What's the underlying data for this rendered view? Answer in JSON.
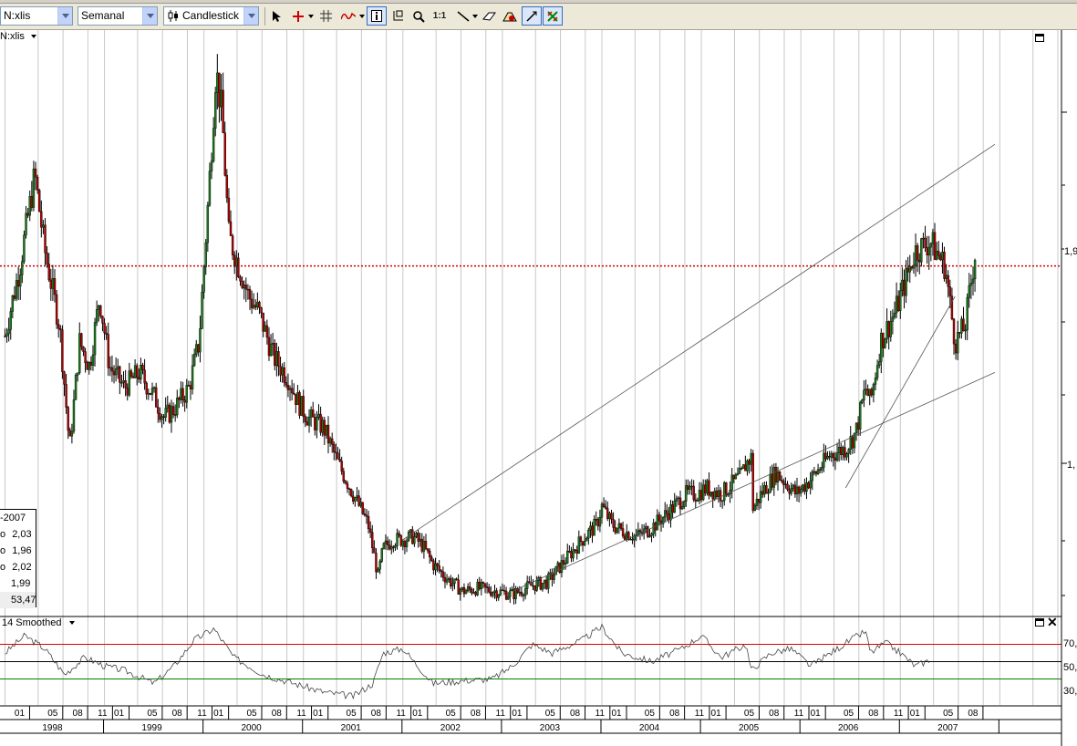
{
  "toolbar": {
    "symbol": "N:xlis",
    "period": "Semanal",
    "chart_style": "Candlestick",
    "icons": [
      "pointer-icon",
      "crosshair-icon",
      "grid-icon",
      "indicator-icon",
      "info-icon",
      "zoom-area-icon",
      "zoom-icon",
      "zoom-reset-icon",
      "line-tool-icon",
      "eraser-icon",
      "properties-icon",
      "autoscale-icon",
      "grid-toggle-icon"
    ],
    "zoom_reset_label": "1:1"
  },
  "price_panel": {
    "title": "N:xlis",
    "price_tags": {
      "current": "1,9",
      "lower": "1,"
    },
    "reference_line_color": "#cc0000"
  },
  "data_window": {
    "date": "-2007",
    "rows": [
      {
        "label": "o",
        "value": "2,03"
      },
      {
        "label": "o",
        "value": "1,96"
      },
      {
        "label": "o",
        "value": "2,02"
      },
      {
        "label": "",
        "value": "1,99"
      },
      {
        "label": "",
        "value": "53,47"
      }
    ]
  },
  "indicator_panel": {
    "title": "14 Smoothed",
    "levels": [
      "70,",
      "50,",
      "30,"
    ],
    "level_colors": {
      "upper": "#e00000",
      "middle": "#000000",
      "lower": "#008000"
    }
  },
  "time_axis": {
    "months": [
      "01",
      "05",
      "08",
      "11",
      "01",
      "05",
      "08",
      "11",
      "01",
      "05",
      "08",
      "11",
      "01",
      "05",
      "08",
      "11",
      "01",
      "05",
      "08",
      "11",
      "01",
      "05",
      "08",
      "11",
      "01",
      "05",
      "08",
      "11",
      "01",
      "05",
      "08",
      "11",
      "01",
      "05",
      "08",
      "11",
      "01",
      "05",
      "08"
    ],
    "years": [
      "1998",
      "1999",
      "2000",
      "2001",
      "2002",
      "2003",
      "2004",
      "2005",
      "2006",
      "2007"
    ]
  },
  "chart_data": {
    "type": "candlestick",
    "period": "weekly",
    "x_range": [
      "1998-01",
      "2007-10"
    ],
    "price_path": [
      [
        1998.0,
        1.72
      ],
      [
        1998.15,
        1.95
      ],
      [
        1998.3,
        2.25
      ],
      [
        1998.4,
        2.0
      ],
      [
        1998.55,
        1.75
      ],
      [
        1998.65,
        1.35
      ],
      [
        1998.75,
        1.7
      ],
      [
        1998.85,
        1.62
      ],
      [
        1998.95,
        1.85
      ],
      [
        1999.05,
        1.62
      ],
      [
        1999.2,
        1.55
      ],
      [
        1999.35,
        1.6
      ],
      [
        1999.5,
        1.52
      ],
      [
        1999.6,
        1.45
      ],
      [
        1999.7,
        1.48
      ],
      [
        1999.85,
        1.55
      ],
      [
        1999.95,
        1.7
      ],
      [
        2000.05,
        2.2
      ],
      [
        2000.12,
        2.6
      ],
      [
        2000.18,
        2.45
      ],
      [
        2000.25,
        2.05
      ],
      [
        2000.35,
        1.95
      ],
      [
        2000.45,
        1.85
      ],
      [
        2000.55,
        1.8
      ],
      [
        2000.7,
        1.65
      ],
      [
        2000.85,
        1.58
      ],
      [
        2000.95,
        1.5
      ],
      [
        2001.05,
        1.45
      ],
      [
        2001.2,
        1.42
      ],
      [
        2001.35,
        1.3
      ],
      [
        2001.5,
        1.2
      ],
      [
        2001.65,
        1.1
      ],
      [
        2001.75,
        0.93
      ],
      [
        2001.8,
        1.02
      ],
      [
        2001.9,
        1.05
      ],
      [
        2002.0,
        1.05
      ],
      [
        2002.1,
        1.06
      ],
      [
        2002.2,
        1.03
      ],
      [
        2002.3,
        0.97
      ],
      [
        2002.45,
        0.92
      ],
      [
        2002.6,
        0.88
      ],
      [
        2002.75,
        0.89
      ],
      [
        2002.95,
        0.88
      ],
      [
        2003.1,
        0.87
      ],
      [
        2003.3,
        0.9
      ],
      [
        2003.45,
        0.91
      ],
      [
        2003.6,
        0.97
      ],
      [
        2003.8,
        1.05
      ],
      [
        2003.95,
        1.1
      ],
      [
        2004.0,
        1.16
      ],
      [
        2004.1,
        1.1
      ],
      [
        2004.2,
        1.08
      ],
      [
        2004.35,
        1.06
      ],
      [
        2004.5,
        1.09
      ],
      [
        2004.7,
        1.15
      ],
      [
        2004.85,
        1.2
      ],
      [
        2004.95,
        1.2
      ],
      [
        2005.05,
        1.22
      ],
      [
        2005.2,
        1.2
      ],
      [
        2005.4,
        1.26
      ],
      [
        2005.45,
        1.3
      ],
      [
        2005.5,
        1.32
      ],
      [
        2005.52,
        1.15
      ],
      [
        2005.6,
        1.2
      ],
      [
        2005.75,
        1.27
      ],
      [
        2005.9,
        1.22
      ],
      [
        2005.95,
        1.2
      ],
      [
        2006.1,
        1.25
      ],
      [
        2006.3,
        1.33
      ],
      [
        2006.45,
        1.35
      ],
      [
        2006.55,
        1.4
      ],
      [
        2006.65,
        1.55
      ],
      [
        2006.7,
        1.5
      ],
      [
        2006.8,
        1.7
      ],
      [
        2006.95,
        1.8
      ],
      [
        2007.05,
        1.9
      ],
      [
        2007.15,
        2.0
      ],
      [
        2007.3,
        2.03
      ],
      [
        2007.45,
        1.95
      ],
      [
        2007.55,
        1.7
      ],
      [
        2007.65,
        1.75
      ],
      [
        2007.75,
        1.99
      ]
    ],
    "reference_price": 1.95,
    "channel_lines": [
      {
        "from": [
          2002.0,
          1.05
        ],
        "to": [
          2007.95,
          2.35
        ]
      },
      {
        "from": [
          2003.1,
          0.88
        ],
        "to": [
          2007.95,
          1.6
        ]
      },
      {
        "from": [
          2006.45,
          1.22
        ],
        "to": [
          2007.55,
          1.85
        ]
      }
    ],
    "indicator": {
      "name": "14 Smoothed",
      "levels": [
        70,
        50,
        30
      ],
      "values_at": [
        [
          1998.0,
          60
        ],
        [
          1998.2,
          80
        ],
        [
          1998.4,
          65
        ],
        [
          1998.6,
          35
        ],
        [
          1998.8,
          55
        ],
        [
          1999.0,
          45
        ],
        [
          1999.2,
          40
        ],
        [
          1999.5,
          25
        ],
        [
          1999.7,
          45
        ],
        [
          1999.9,
          75
        ],
        [
          2000.1,
          88
        ],
        [
          2000.3,
          55
        ],
        [
          2000.6,
          35
        ],
        [
          2000.9,
          25
        ],
        [
          2001.2,
          15
        ],
        [
          2001.5,
          10
        ],
        [
          2001.7,
          25
        ],
        [
          2001.8,
          60
        ],
        [
          2002.0,
          65
        ],
        [
          2002.3,
          25
        ],
        [
          2002.6,
          28
        ],
        [
          2002.9,
          30
        ],
        [
          2003.1,
          45
        ],
        [
          2003.3,
          70
        ],
        [
          2003.5,
          60
        ],
        [
          2003.8,
          75
        ],
        [
          2004.0,
          90
        ],
        [
          2004.2,
          60
        ],
        [
          2004.5,
          50
        ],
        [
          2004.8,
          65
        ],
        [
          2005.0,
          80
        ],
        [
          2005.2,
          55
        ],
        [
          2005.45,
          70
        ],
        [
          2005.5,
          40
        ],
        [
          2005.7,
          60
        ],
        [
          2005.9,
          65
        ],
        [
          2006.1,
          45
        ],
        [
          2006.3,
          60
        ],
        [
          2006.5,
          75
        ],
        [
          2006.65,
          85
        ],
        [
          2006.7,
          60
        ],
        [
          2006.85,
          72
        ],
        [
          2007.0,
          60
        ],
        [
          2007.15,
          45
        ],
        [
          2007.3,
          52
        ]
      ]
    }
  }
}
